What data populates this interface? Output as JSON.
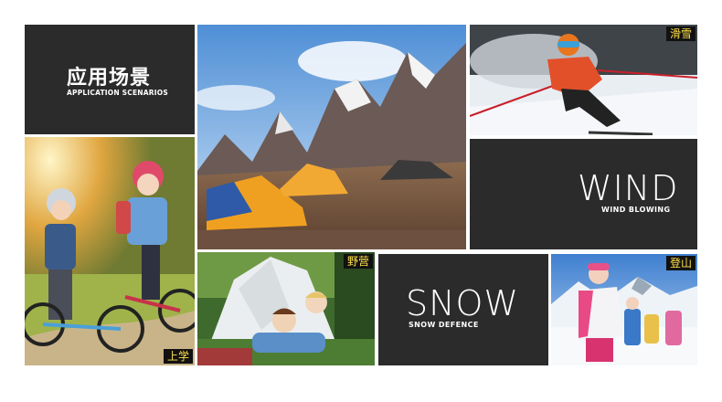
{
  "header": {
    "title_cn": "应用场景",
    "title_en": "APPLICATION SCENARIOS"
  },
  "tiles": {
    "mountains": {
      "image": "mountain-camp-photo"
    },
    "ski": {
      "label": "滑雪",
      "image": "child-skiing-photo"
    },
    "wind": {
      "title": "WIND",
      "subtitle": "WIND BLOWING"
    },
    "kids": {
      "label": "上学",
      "image": "children-bikes-photo"
    },
    "camp": {
      "label": "野营",
      "image": "children-tent-photo"
    },
    "snow": {
      "title": "SNOW",
      "subtitle": "SNOW DEFENCE"
    },
    "climb": {
      "label": "登山",
      "image": "children-snow-mountain-photo"
    }
  },
  "colors": {
    "panel": "#2b2b2b",
    "tag_bg": "#111111",
    "tag_text": "#ffe14a"
  }
}
